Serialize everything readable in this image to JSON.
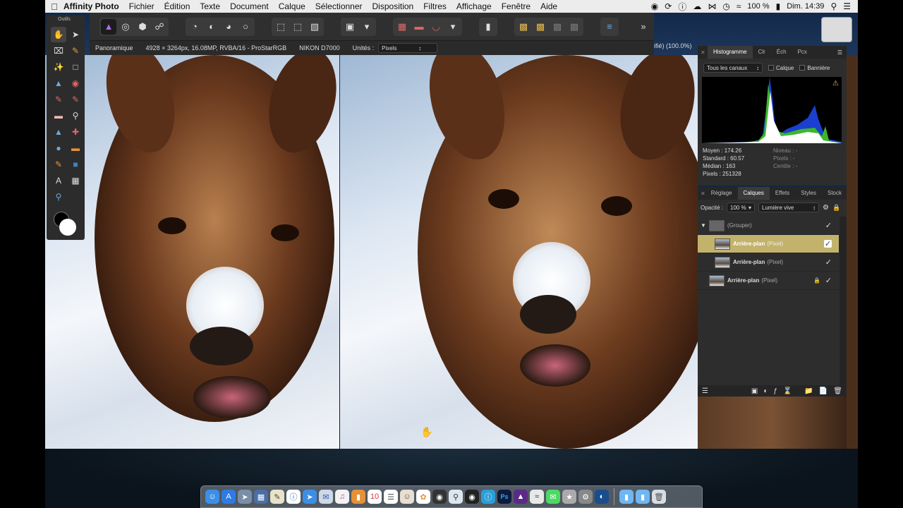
{
  "menubar": {
    "app_name": "Affinity Photo",
    "items": [
      "Fichier",
      "Édition",
      "Texte",
      "Document",
      "Calque",
      "Sélectionner",
      "Disposition",
      "Filtres",
      "Affichage",
      "Fenêtre",
      "Aide"
    ],
    "battery": "100 %",
    "clock": "Dim. 14:39"
  },
  "tools_panel": {
    "title": "Outils"
  },
  "context_toolbar": {
    "mode": "Panoramique",
    "document_info": "4928 × 3264px, 16.08MP, RVBA/16 - ProStarRGB",
    "camera": "NIKON D7000",
    "units_label": "Unités :",
    "units_value": "Pixels"
  },
  "window_title_fragment": "ifié) (100.0%)",
  "histogram_panel": {
    "tabs": [
      "Histogramme",
      "Clr",
      "Éch",
      "Pcx"
    ],
    "channel_select": "Tous les canaux",
    "calque_label": "Calque",
    "banniere_label": "Bannière",
    "stats_left": [
      {
        "label": "Moyen",
        "value": "174.26"
      },
      {
        "label": "Standard",
        "value": "60.57"
      },
      {
        "label": "Médian",
        "value": "163"
      },
      {
        "label": "Pixels",
        "value": "251328"
      }
    ],
    "stats_right": [
      {
        "label": "Niveau",
        "value": "-"
      },
      {
        "label": "Pixels",
        "value": "-"
      },
      {
        "label": "Centile",
        "value": "-"
      }
    ]
  },
  "layers_panel": {
    "tabs": [
      "Réglage",
      "Calques",
      "Effets",
      "Styles",
      "Stock"
    ],
    "opacity_label": "Opacité :",
    "opacity_value": "100 %",
    "blend_mode": "Lumière vive",
    "layers": [
      {
        "name": "(Grouper)",
        "kind": "",
        "selected": false,
        "group": true
      },
      {
        "name": "Arrière-plan",
        "kind": "(Pixel)",
        "selected": true,
        "group": false
      },
      {
        "name": "Arrière-plan",
        "kind": "(Pixel)",
        "selected": false,
        "group": false
      },
      {
        "name": "Arrière-plan",
        "kind": "(Pixel)",
        "selected": false,
        "group": false,
        "locked": true
      }
    ]
  }
}
